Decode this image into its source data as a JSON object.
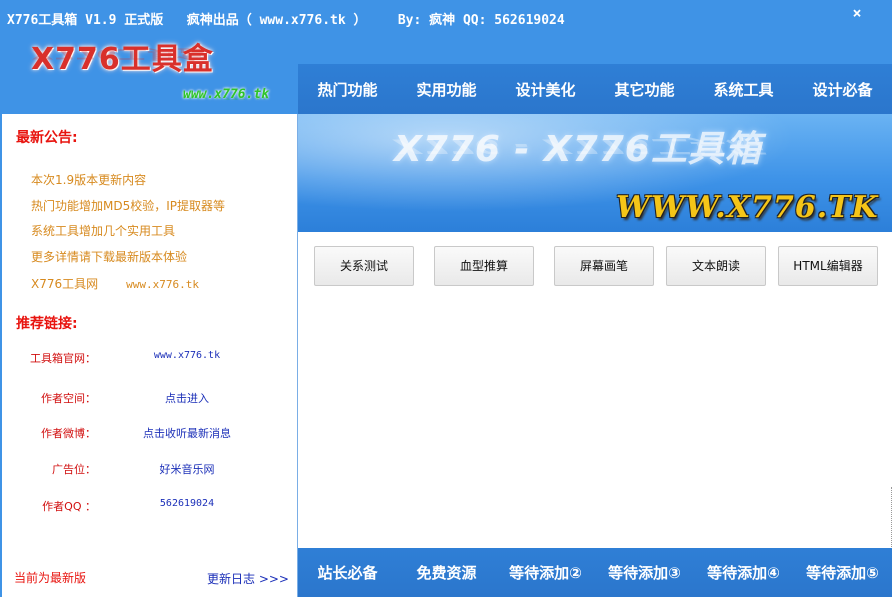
{
  "titlebar": {
    "app_title": "X776工具箱 V1.9 正式版",
    "author": "疯神出品（ www.x776.tk ）",
    "by": "By: 疯神 QQ: 562619024",
    "close_glyph": "×"
  },
  "logo": {
    "name": "X776工具盒",
    "url": "www.x776.tk"
  },
  "top_nav": [
    "热门功能",
    "实用功能",
    "设计美化",
    "其它功能",
    "系统工具",
    "设计必备"
  ],
  "banner": {
    "title": "X776 - X776工具箱",
    "url": "WWW.X776.TK"
  },
  "sidebar": {
    "announcement_title": "最新公告:",
    "announcements": [
      "本次1.9版本更新内容",
      "热门功能增加MD5校验，IP提取器等",
      "系统工具增加几个实用工具",
      "更多详情请下载最新版本体验"
    ],
    "site_line": {
      "name": "X776工具网",
      "url": "www.x776.tk"
    },
    "links_title": "推荐链接:",
    "links": [
      {
        "label": "工具箱官网：",
        "value": "www.x776.tk"
      },
      {
        "label": "作者空间：",
        "value": "点击进入"
      },
      {
        "label": "作者微博：",
        "value": "点击收听最新消息"
      },
      {
        "label": "广告位：",
        "value": "好米音乐网"
      },
      {
        "label": "作者QQ ：",
        "value": "562619024"
      }
    ],
    "status": "当前为最新版",
    "changelog": "更新日志 >>>"
  },
  "tools": [
    "关系测试",
    "血型推算",
    "屏幕画笔",
    "文本朗读",
    "HTML编辑器"
  ],
  "bottom_nav": [
    "站长必备",
    "免费资源",
    "等待添加②",
    "等待添加③",
    "等待添加④",
    "等待添加⑤"
  ]
}
